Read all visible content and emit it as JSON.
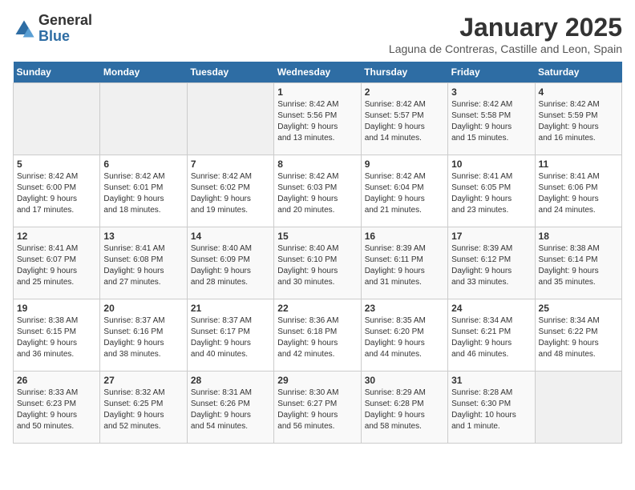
{
  "logo": {
    "general": "General",
    "blue": "Blue"
  },
  "title": "January 2025",
  "subtitle": "Laguna de Contreras, Castille and Leon, Spain",
  "days_header": [
    "Sunday",
    "Monday",
    "Tuesday",
    "Wednesday",
    "Thursday",
    "Friday",
    "Saturday"
  ],
  "weeks": [
    [
      {
        "day": "",
        "info": ""
      },
      {
        "day": "",
        "info": ""
      },
      {
        "day": "",
        "info": ""
      },
      {
        "day": "1",
        "info": "Sunrise: 8:42 AM\nSunset: 5:56 PM\nDaylight: 9 hours\nand 13 minutes."
      },
      {
        "day": "2",
        "info": "Sunrise: 8:42 AM\nSunset: 5:57 PM\nDaylight: 9 hours\nand 14 minutes."
      },
      {
        "day": "3",
        "info": "Sunrise: 8:42 AM\nSunset: 5:58 PM\nDaylight: 9 hours\nand 15 minutes."
      },
      {
        "day": "4",
        "info": "Sunrise: 8:42 AM\nSunset: 5:59 PM\nDaylight: 9 hours\nand 16 minutes."
      }
    ],
    [
      {
        "day": "5",
        "info": "Sunrise: 8:42 AM\nSunset: 6:00 PM\nDaylight: 9 hours\nand 17 minutes."
      },
      {
        "day": "6",
        "info": "Sunrise: 8:42 AM\nSunset: 6:01 PM\nDaylight: 9 hours\nand 18 minutes."
      },
      {
        "day": "7",
        "info": "Sunrise: 8:42 AM\nSunset: 6:02 PM\nDaylight: 9 hours\nand 19 minutes."
      },
      {
        "day": "8",
        "info": "Sunrise: 8:42 AM\nSunset: 6:03 PM\nDaylight: 9 hours\nand 20 minutes."
      },
      {
        "day": "9",
        "info": "Sunrise: 8:42 AM\nSunset: 6:04 PM\nDaylight: 9 hours\nand 21 minutes."
      },
      {
        "day": "10",
        "info": "Sunrise: 8:41 AM\nSunset: 6:05 PM\nDaylight: 9 hours\nand 23 minutes."
      },
      {
        "day": "11",
        "info": "Sunrise: 8:41 AM\nSunset: 6:06 PM\nDaylight: 9 hours\nand 24 minutes."
      }
    ],
    [
      {
        "day": "12",
        "info": "Sunrise: 8:41 AM\nSunset: 6:07 PM\nDaylight: 9 hours\nand 25 minutes."
      },
      {
        "day": "13",
        "info": "Sunrise: 8:41 AM\nSunset: 6:08 PM\nDaylight: 9 hours\nand 27 minutes."
      },
      {
        "day": "14",
        "info": "Sunrise: 8:40 AM\nSunset: 6:09 PM\nDaylight: 9 hours\nand 28 minutes."
      },
      {
        "day": "15",
        "info": "Sunrise: 8:40 AM\nSunset: 6:10 PM\nDaylight: 9 hours\nand 30 minutes."
      },
      {
        "day": "16",
        "info": "Sunrise: 8:39 AM\nSunset: 6:11 PM\nDaylight: 9 hours\nand 31 minutes."
      },
      {
        "day": "17",
        "info": "Sunrise: 8:39 AM\nSunset: 6:12 PM\nDaylight: 9 hours\nand 33 minutes."
      },
      {
        "day": "18",
        "info": "Sunrise: 8:38 AM\nSunset: 6:14 PM\nDaylight: 9 hours\nand 35 minutes."
      }
    ],
    [
      {
        "day": "19",
        "info": "Sunrise: 8:38 AM\nSunset: 6:15 PM\nDaylight: 9 hours\nand 36 minutes."
      },
      {
        "day": "20",
        "info": "Sunrise: 8:37 AM\nSunset: 6:16 PM\nDaylight: 9 hours\nand 38 minutes."
      },
      {
        "day": "21",
        "info": "Sunrise: 8:37 AM\nSunset: 6:17 PM\nDaylight: 9 hours\nand 40 minutes."
      },
      {
        "day": "22",
        "info": "Sunrise: 8:36 AM\nSunset: 6:18 PM\nDaylight: 9 hours\nand 42 minutes."
      },
      {
        "day": "23",
        "info": "Sunrise: 8:35 AM\nSunset: 6:20 PM\nDaylight: 9 hours\nand 44 minutes."
      },
      {
        "day": "24",
        "info": "Sunrise: 8:34 AM\nSunset: 6:21 PM\nDaylight: 9 hours\nand 46 minutes."
      },
      {
        "day": "25",
        "info": "Sunrise: 8:34 AM\nSunset: 6:22 PM\nDaylight: 9 hours\nand 48 minutes."
      }
    ],
    [
      {
        "day": "26",
        "info": "Sunrise: 8:33 AM\nSunset: 6:23 PM\nDaylight: 9 hours\nand 50 minutes."
      },
      {
        "day": "27",
        "info": "Sunrise: 8:32 AM\nSunset: 6:25 PM\nDaylight: 9 hours\nand 52 minutes."
      },
      {
        "day": "28",
        "info": "Sunrise: 8:31 AM\nSunset: 6:26 PM\nDaylight: 9 hours\nand 54 minutes."
      },
      {
        "day": "29",
        "info": "Sunrise: 8:30 AM\nSunset: 6:27 PM\nDaylight: 9 hours\nand 56 minutes."
      },
      {
        "day": "30",
        "info": "Sunrise: 8:29 AM\nSunset: 6:28 PM\nDaylight: 9 hours\nand 58 minutes."
      },
      {
        "day": "31",
        "info": "Sunrise: 8:28 AM\nSunset: 6:30 PM\nDaylight: 10 hours\nand 1 minute."
      },
      {
        "day": "",
        "info": ""
      }
    ]
  ]
}
